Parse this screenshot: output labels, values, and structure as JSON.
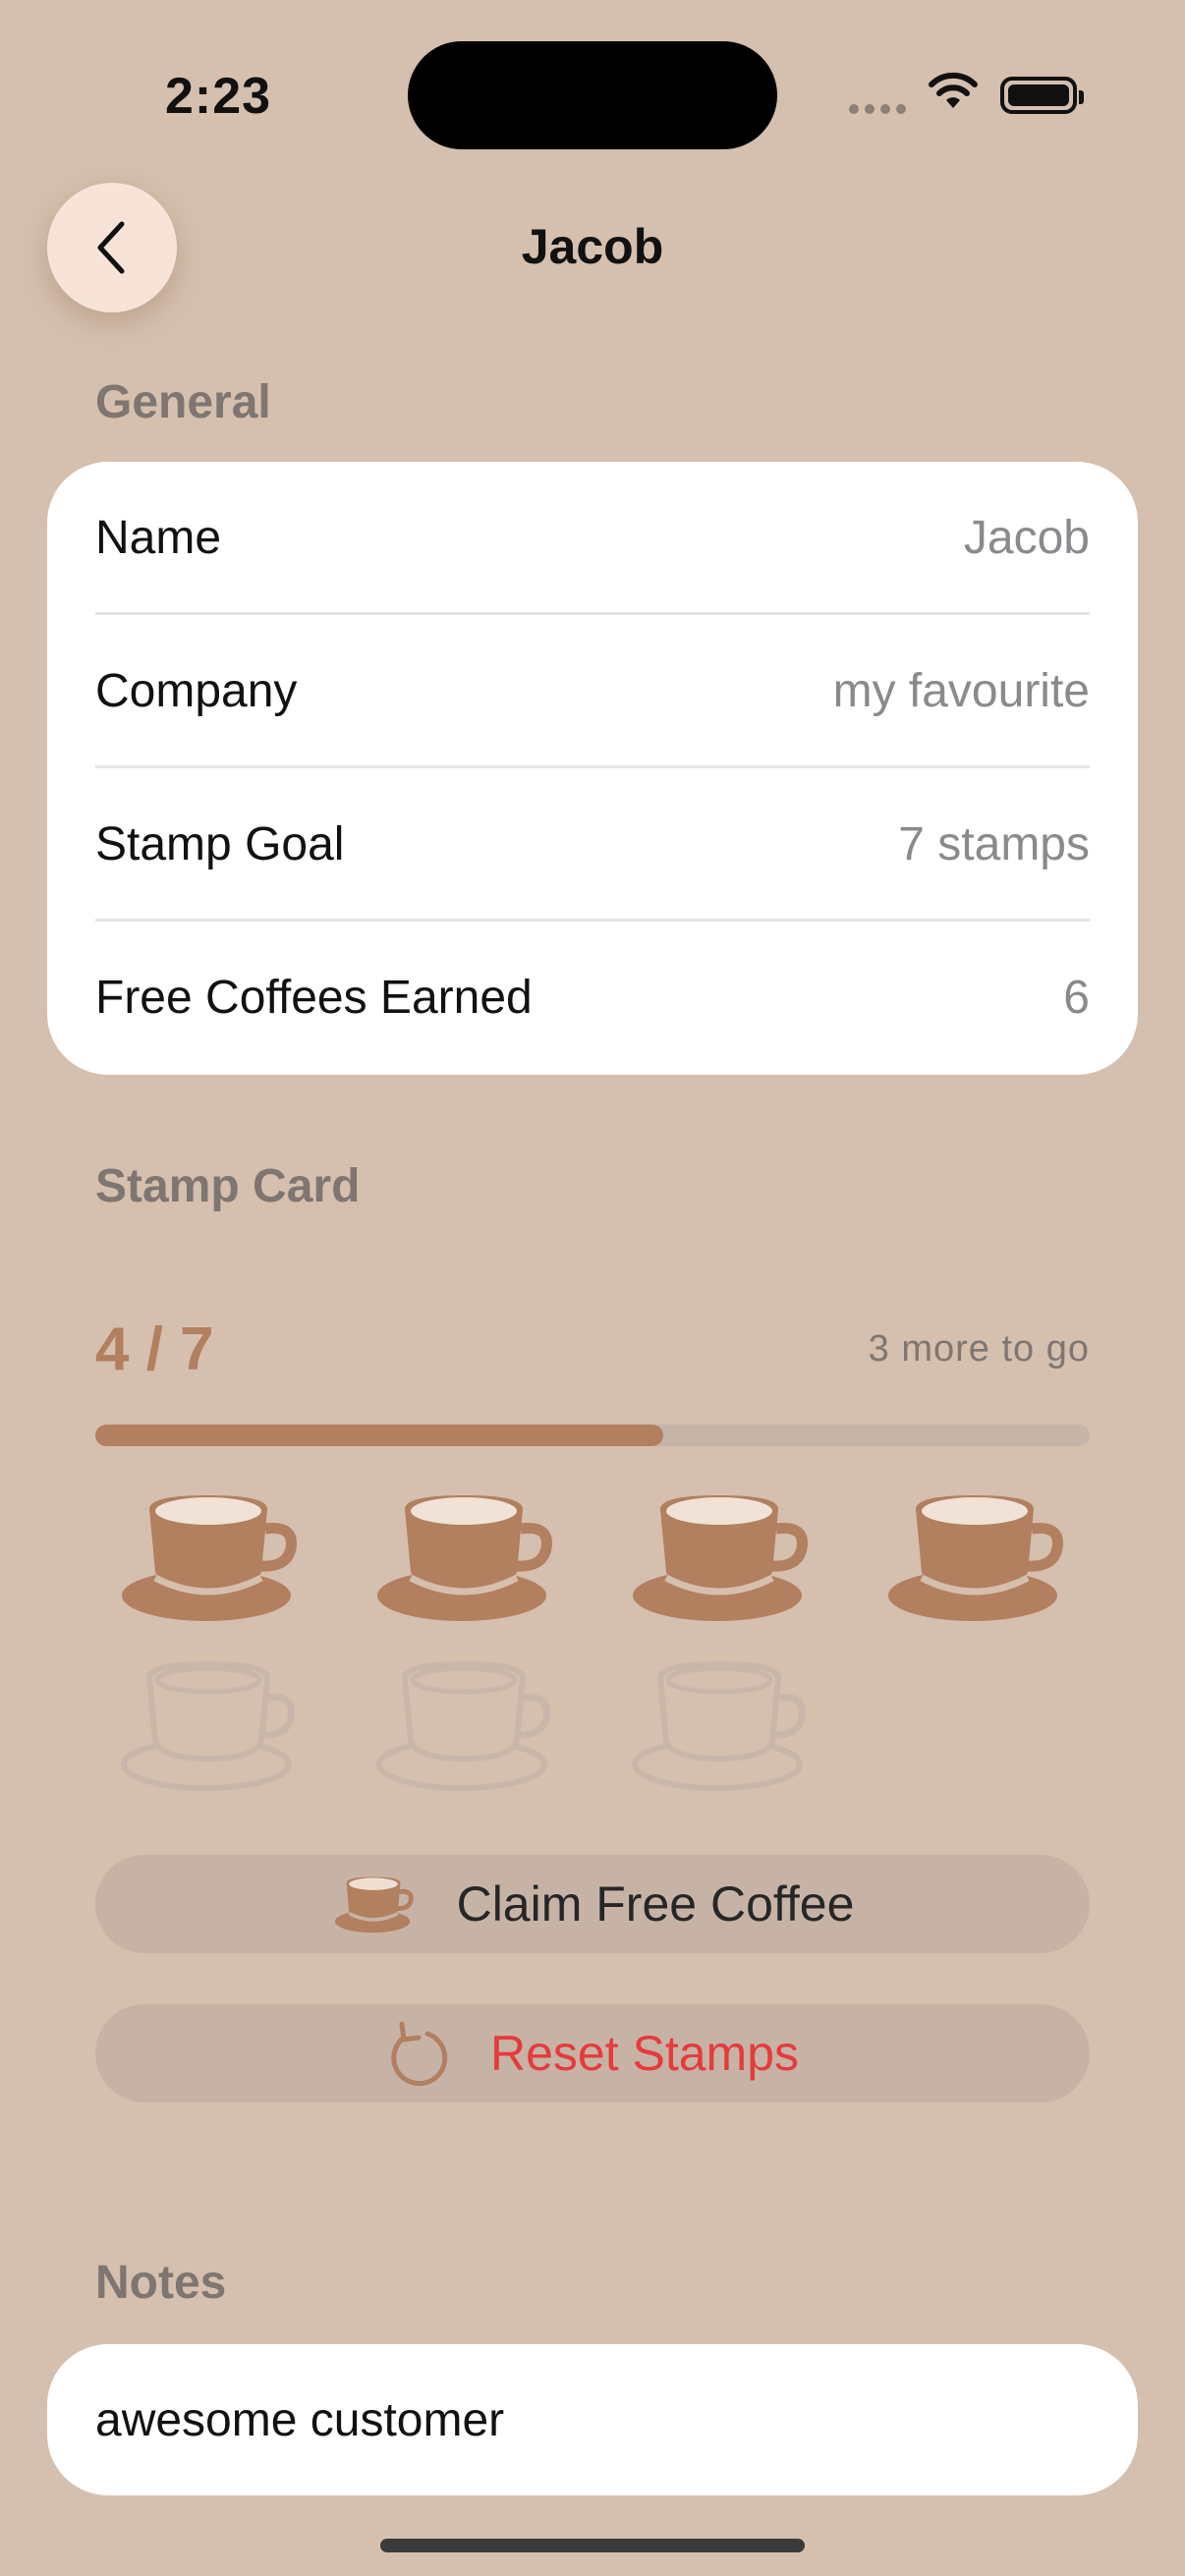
{
  "status_bar": {
    "time": "2:23"
  },
  "nav": {
    "title": "Jacob",
    "back_icon": "chevron-left-icon"
  },
  "general": {
    "header": "General",
    "rows": [
      {
        "label": "Name",
        "value": "Jacob"
      },
      {
        "label": "Company",
        "value": "my favourite"
      },
      {
        "label": "Stamp Goal",
        "value": "7 stamps"
      },
      {
        "label": "Free Coffees Earned",
        "value": "6"
      }
    ]
  },
  "stamp_card": {
    "header": "Stamp Card",
    "progress_text": "4 / 7",
    "remaining_text": "3 more to go",
    "stamps_filled": 4,
    "stamp_goal": 7,
    "progress_fraction": 0.571,
    "accent_color": "#B27F5F",
    "empty_color": "#C9B6AA",
    "claim_label": "Claim Free Coffee",
    "reset_label": "Reset Stamps",
    "claim_icon": "coffee-cup-icon",
    "reset_icon": "reset-arrow-icon"
  },
  "notes": {
    "header": "Notes",
    "text": "awesome customer"
  }
}
